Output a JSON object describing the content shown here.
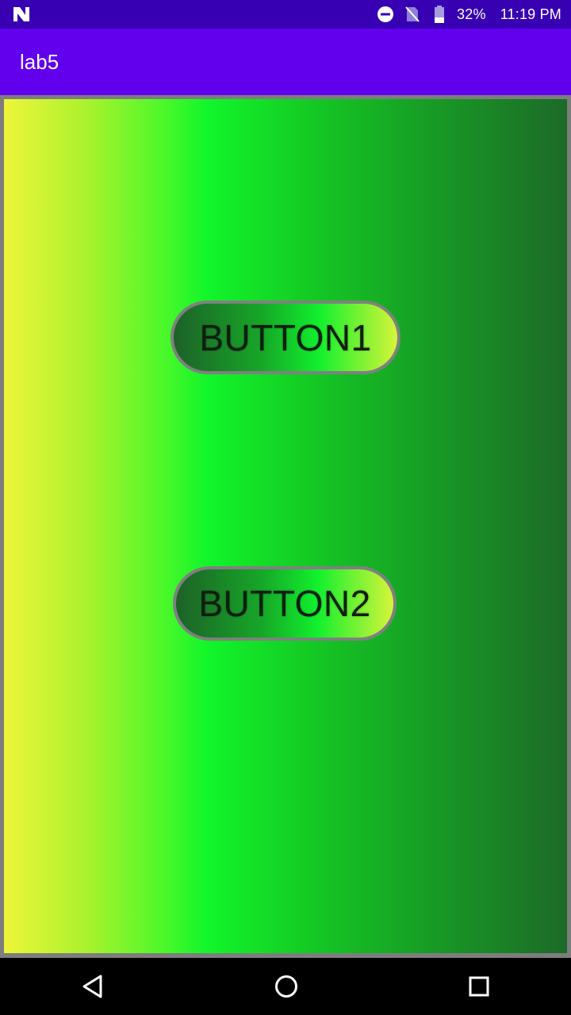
{
  "status_bar": {
    "battery_percent": "32%",
    "time": "11:19 PM",
    "icons": [
      "n-logo-icon",
      "do-not-disturb-icon",
      "no-sim-icon",
      "battery-icon"
    ]
  },
  "app_bar": {
    "title": "lab5"
  },
  "colors": {
    "status_bar": "#3700b3",
    "app_bar": "#6200ee",
    "panel_border": "#7d7d7d",
    "gradient": [
      "#eef53a",
      "#12f62a",
      "#1d6a28"
    ],
    "button_border": "#808080"
  },
  "buttons": [
    {
      "label": "BUTTON1"
    },
    {
      "label": "BUTTON2"
    }
  ],
  "nav_bar": {
    "icons": [
      "back-icon",
      "home-icon",
      "recents-icon"
    ]
  }
}
